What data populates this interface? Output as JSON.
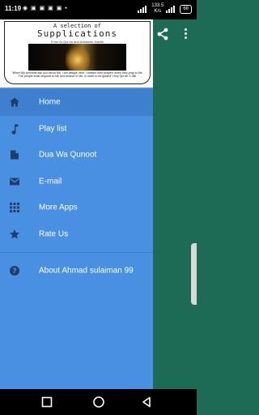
{
  "status": {
    "time": "11:19",
    "icons": "◉ ▣ ▣ ▣ ▣ •",
    "speed_value": "133.5",
    "speed_unit": "K/s",
    "battery": "68"
  },
  "header": {
    "title_line1": "A selection of",
    "title_line2": "Supplications",
    "title_line3": "From Al-Qur'an and Authentic Hadith",
    "quote": "\"When My servants ask you about Me, I am always near. I answer their prayers when they pray to Me. The people shall respond to Me and believe in Me, in order to be guided\" Holy Qur'an 2:186"
  },
  "menu": {
    "items": [
      {
        "label": "Home",
        "icon": "home-icon"
      },
      {
        "label": "Play list",
        "icon": "music-note-icon"
      },
      {
        "label": "Dua Wa Qunoot",
        "icon": "document-icon"
      },
      {
        "label": "E-mail",
        "icon": "email-icon"
      },
      {
        "label": "More Apps",
        "icon": "grid-icon"
      },
      {
        "label": "Rate Us",
        "icon": "star-icon"
      },
      {
        "label": "About Ahmad sulaiman 99",
        "icon": "help-icon"
      }
    ]
  },
  "colors": {
    "drawer": "#4a90e2",
    "active_item": "#3f7fcf",
    "app_bar": "#1d6a55"
  }
}
